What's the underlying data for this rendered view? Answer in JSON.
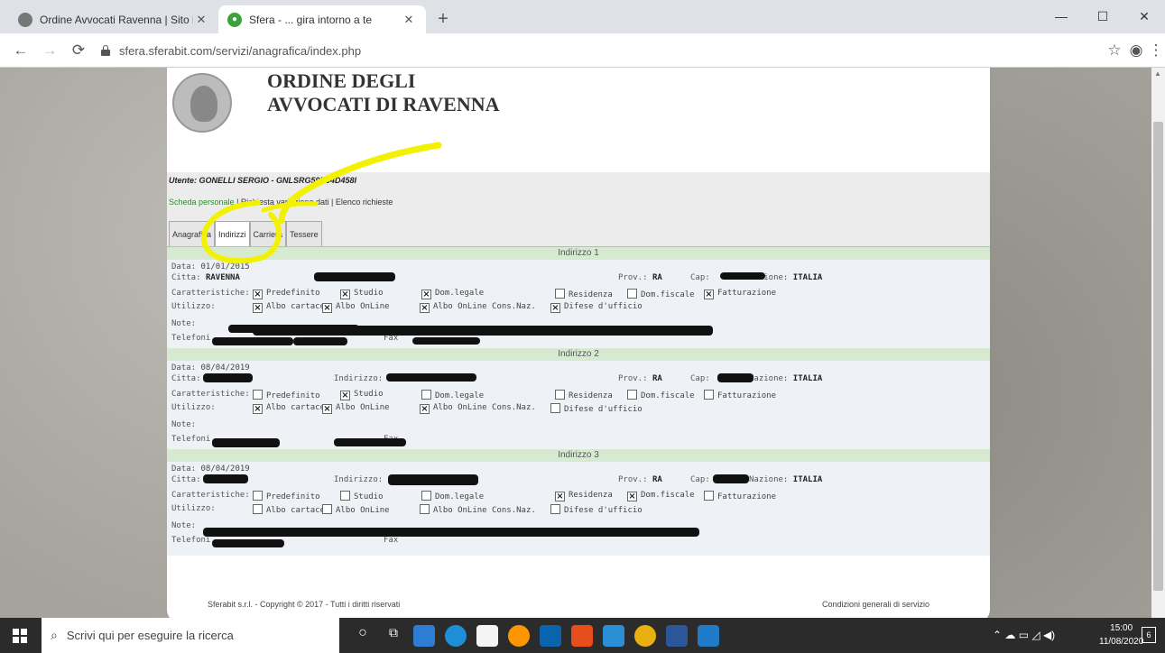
{
  "browser": {
    "tabs": [
      {
        "title": "Ordine Avvocati Ravenna | Sito i",
        "active": false
      },
      {
        "title": "Sfera - ... gira intorno a te",
        "active": true
      }
    ],
    "new_tab": "+",
    "url": "sfera.sferabit.com/servizi/anagrafica/index.php",
    "window": {
      "minimize": "—",
      "maximize": "☐",
      "close": "✕"
    }
  },
  "header": {
    "title_line1": "ORDINE DEGLI",
    "title_line2": "AVVOCATI DI RAVENNA"
  },
  "user": "Utente: GONELLI SERGIO - GNLSRG59D04D458I",
  "links": {
    "scheda": "Scheda personale",
    "sep1": " | ",
    "richiesta": "Richiesta variazione dati",
    "sep2": " | ",
    "elenco": "Elenco richieste"
  },
  "tabs": [
    "Anagrafica",
    "Indirizzi",
    "Carriera",
    "Tessere"
  ],
  "active_tab": "Indirizzi",
  "labels": {
    "data": "Data:",
    "citta": "Citta:",
    "indirizzo": "Indirizzo:",
    "prov": "Prov.:",
    "cap": "Cap:",
    "nazione": "Nazione:",
    "caratteristiche": "Caratteristiche:",
    "utilizzo": "Utilizzo:",
    "note": "Note:",
    "telefoni": "Telefoni",
    "fax": "Fax"
  },
  "char_labels": [
    "Predefinito",
    "Studio",
    "Dom.legale",
    "Residenza",
    "Dom.fiscale",
    "Fatturazione"
  ],
  "use_labels": [
    "Albo cartaceo",
    "Albo OnLine",
    "Albo OnLine Cons.Naz.",
    "Difese d'ufficio"
  ],
  "addresses": [
    {
      "header": "Indirizzo 1",
      "data": "01/01/2015",
      "citta": "RAVENNA",
      "prov": "RA",
      "nazione": "ITALIA",
      "char": [
        true,
        true,
        true,
        false,
        false,
        true
      ],
      "use": [
        true,
        true,
        true,
        true
      ]
    },
    {
      "header": "Indirizzo 2",
      "data": "08/04/2019",
      "citta": "",
      "prov": "RA",
      "nazione": "ITALIA",
      "char": [
        false,
        true,
        false,
        false,
        false,
        false
      ],
      "use": [
        true,
        true,
        true,
        false
      ]
    },
    {
      "header": "Indirizzo 3",
      "data": "08/04/2019",
      "citta": "",
      "prov": "RA",
      "nazione": "ITALIA",
      "char": [
        false,
        false,
        false,
        true,
        true,
        false
      ],
      "use": [
        false,
        false,
        false,
        false
      ]
    }
  ],
  "footer": {
    "copyright": "Sferabit s.r.l. - Copyright © 2017 - Tutti i diritti riservati",
    "terms": "Condizioni generali di servizio"
  },
  "taskbar": {
    "search_placeholder": "Scrivi qui per eseguire la ricerca",
    "time": "15:00",
    "date": "11/08/2020",
    "notifications": "6"
  },
  "colors": {
    "highlight": "#f2f200",
    "link_green": "#2e8b2e",
    "section_header": "#d6ead2"
  }
}
